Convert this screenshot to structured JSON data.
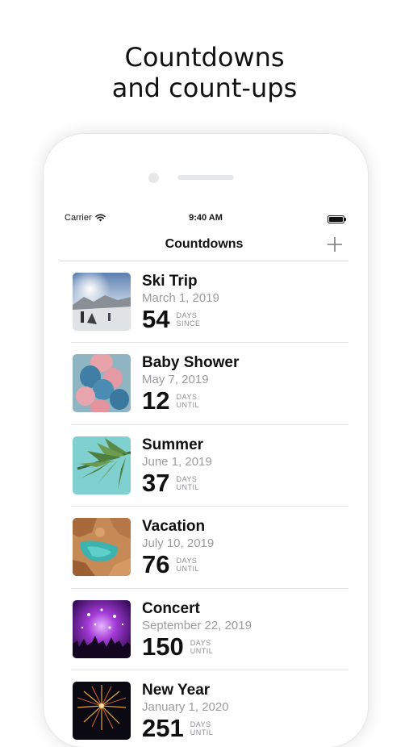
{
  "headline": {
    "line1": "Countdowns",
    "line2": "and count-ups"
  },
  "status_bar": {
    "carrier": "Carrier",
    "time": "9:40 AM",
    "icons": [
      "wifi-icon",
      "battery-icon"
    ]
  },
  "nav": {
    "title": "Countdowns",
    "add_icon": "plus-icon"
  },
  "events": [
    {
      "title": "Ski Trip",
      "date": "March 1, 2019",
      "count": "54",
      "unit_top": "DAYS",
      "unit_bottom": "SINCE",
      "image": "ski-slope-photo"
    },
    {
      "title": "Baby Shower",
      "date": "May 7, 2019",
      "count": "12",
      "unit_top": "DAYS",
      "unit_bottom": "UNTIL",
      "image": "balloons-photo"
    },
    {
      "title": "Summer",
      "date": "June 1, 2019",
      "count": "37",
      "unit_top": "DAYS",
      "unit_bottom": "UNTIL",
      "image": "palm-leaf-photo"
    },
    {
      "title": "Vacation",
      "date": "July 10, 2019",
      "count": "76",
      "unit_top": "DAYS",
      "unit_bottom": "UNTIL",
      "image": "coastal-cove-photo"
    },
    {
      "title": "Concert",
      "date": "September 22, 2019",
      "count": "150",
      "unit_top": "DAYS",
      "unit_bottom": "UNTIL",
      "image": "concert-crowd-photo"
    },
    {
      "title": "New Year",
      "date": "January 1, 2020",
      "count": "251",
      "unit_top": "DAYS",
      "unit_bottom": "UNTIL",
      "image": "fireworks-photo"
    }
  ]
}
